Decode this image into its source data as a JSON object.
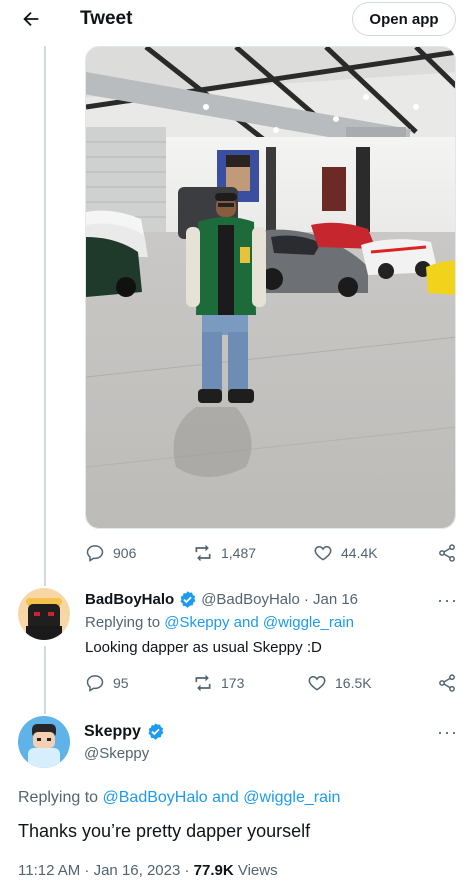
{
  "header": {
    "title": "Tweet",
    "open_app_label": "Open app",
    "back_icon": "arrow-left-icon"
  },
  "original_tweet": {
    "image_alt": "Person in green varsity jacket standing in a garage full of sports cars",
    "stats": {
      "replies": "906",
      "retweets": "1,487",
      "likes": "44.4K"
    }
  },
  "reply": {
    "author": "BadBoyHalo",
    "handle": "@BadBoyHalo",
    "date": "· Jan 16",
    "replying_prefix": "Replying to",
    "replying_users": "@Skeppy and @wiggle_rain",
    "text": "Looking dapper as usual Skeppy :D",
    "stats": {
      "replies": "95",
      "retweets": "173",
      "likes": "16.5K"
    },
    "more": "···"
  },
  "main_tweet": {
    "author": "Skeppy",
    "handle": "@Skeppy",
    "replying_prefix": "Replying to",
    "replying_users": "@BadBoyHalo and @wiggle_rain",
    "text": "Thanks you’re pretty dapper yourself",
    "time": "11:12 AM · Jan 16, 2023 · ",
    "views_count": "77.9K",
    "views_label": " Views",
    "more": "···"
  },
  "colors": {
    "accent": "#1d9bf0",
    "muted": "#536471",
    "verified": "#1d9bf0"
  }
}
